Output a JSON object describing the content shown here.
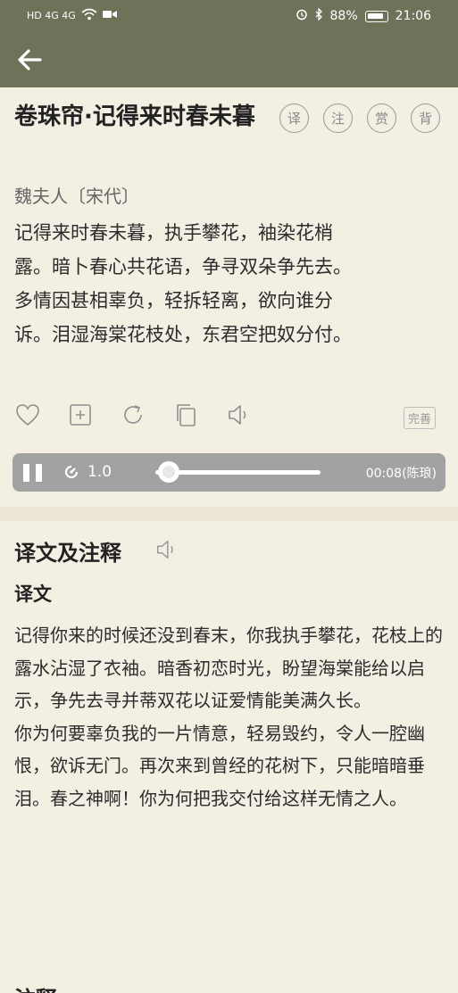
{
  "status_bar": {
    "network": "HD 4G 4G",
    "battery": "88%",
    "time": "21:06"
  },
  "header": {
    "back_icon": "arrow-left-icon"
  },
  "poem": {
    "title": "卷珠帘·记得来时春未暮",
    "author": "魏夫人〔宋代〕",
    "lines": [
      "记得来时春未暮，执手攀花，袖染花梢",
      "露。暗卜春心共花语，争寻双朵争先去。",
      "多情因甚相辜负，轻拆轻离，欲向谁分",
      "诉。泪湿海棠花枝处，东君空把奴分付。"
    ],
    "tools": [
      {
        "label": "译",
        "name": "translate"
      },
      {
        "label": "注",
        "name": "annotate"
      },
      {
        "label": "赏",
        "name": "appreciate"
      },
      {
        "label": "背",
        "name": "recite"
      }
    ],
    "improve_label": "完善"
  },
  "player": {
    "speed": "1.0",
    "progress": 0.08,
    "time": "00:08(陈琅)"
  },
  "section": {
    "title": "译文及注释",
    "sub_title": "译文",
    "paragraphs": [
      "记得你来的时候还没到春末，你我执手攀花，花枝上的露水沾湿了衣袖。暗香初恋时光，盼望海棠能给以启示，争先去寻并蒂双花以证爱情能美满久长。",
      "你为何要辜负我的一片情意，轻易毁约，令人一腔幽恨，欲诉无门。再次来到曾经的花树下，只能暗暗垂泪。春之神啊！你为何把我交付给这样无情之人。"
    ],
    "next_title": "注释"
  },
  "colors": {
    "header": "#6e7258",
    "background": "#f4efe3",
    "player": "#a2a2a2"
  }
}
